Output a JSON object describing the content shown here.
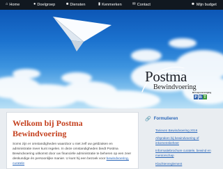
{
  "topnav": {
    "items": [
      {
        "label": "Home",
        "icon": "home-icon"
      },
      {
        "label": "Doelgroep",
        "icon": "users-icon"
      },
      {
        "label": "Diensten",
        "icon": "suitcase-icon"
      },
      {
        "label": "Kenmerken",
        "icon": "chart-icon"
      },
      {
        "label": "Contact",
        "icon": "envelope-icon"
      }
    ],
    "right": {
      "label": "Mijn budget",
      "icon": "user-icon"
    }
  },
  "logo": {
    "title": "Postma",
    "subtitle": "Bewindvoering",
    "badge_caption": "Beroepsvereniging",
    "badge_letters": [
      "P",
      "B",
      "T"
    ],
    "badge_colors": [
      "#2f62ad",
      "#2f62ad",
      "#3f9a3b"
    ]
  },
  "main": {
    "heading": "Welkom bij Postma Bewindvoering",
    "intro": "Soms zijn er omstandigheden waardoor u niet zelf uw geldzaken en administratie meer kunt regelen. In deze omstandigheden biedt Postma Bewindvoering uitkomst door uw financiële administratie te beheren op een zeer deskundige én persoonlijke manier. U kunt hij een bezoek voor ",
    "intro_link": "bewindvoering, curatele"
  },
  "sidebar": {
    "title": "Formulieren",
    "icon": "link-icon",
    "links": [
      "Tarieven Bewindvoering 2016",
      "Afspraken bij bewindvoering of inkomensbeheer",
      "Informatiebrochure curatele, bewind en mentorschap",
      "Klachtenreglement"
    ]
  },
  "colors": {
    "nav_bg": "#111820",
    "heading": "#c4411f",
    "link": "#2a66b8",
    "sky_top": "#0d57b6",
    "sky_bottom": "#b9e0f6"
  }
}
